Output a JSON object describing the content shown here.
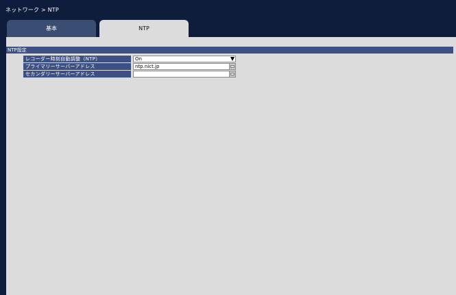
{
  "breadcrumb": "ネットワーク > NTP",
  "tabs": [
    {
      "label": "基本",
      "active": false
    },
    {
      "label": "NTP",
      "active": true
    }
  ],
  "section": {
    "title": "NTP設定"
  },
  "settings": {
    "auto_adjust": {
      "label": "レコーダー時刻自動調整（NTP）",
      "value": "On"
    },
    "primary_server": {
      "label": "プライマリーサーバーアドレス",
      "value": "ntp.nict.jp",
      "button_icon": "keyboard-icon"
    },
    "secondary_server": {
      "label": "セカンダリーサーバーアドレス",
      "value": "",
      "button_icon": "keyboard-icon"
    }
  },
  "colors": {
    "background": "#0f1d3d",
    "panel": "#dcdcdc",
    "header": "#3d5083",
    "tab_inactive": "#3a4d72"
  }
}
